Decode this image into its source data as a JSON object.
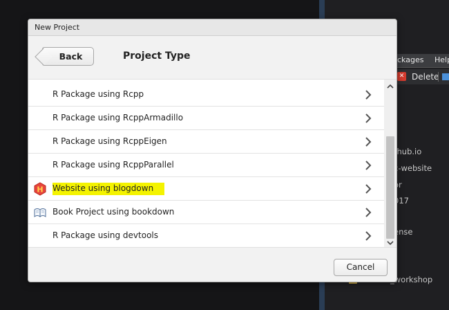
{
  "background": {
    "tabs": [
      "ckages",
      "Help"
    ],
    "toolbar": {
      "delete_label": "Delete"
    },
    "files": [
      "thub.io",
      "c-website",
      "or",
      "017",
      "ense",
      "_workshop"
    ]
  },
  "dialog": {
    "title": "New Project",
    "back_label": "Back",
    "page_title": "Project Type",
    "cancel_label": "Cancel",
    "items": [
      {
        "label": "R Package using Rcpp",
        "icon": null
      },
      {
        "label": "R Package using RcppArmadillo",
        "icon": null
      },
      {
        "label": "R Package using RcppEigen",
        "icon": null
      },
      {
        "label": "R Package using RcppParallel",
        "icon": null
      },
      {
        "label": "Website using blogdown",
        "icon": "hugo-logo-icon",
        "highlighted": true
      },
      {
        "label": "Book Project using bookdown",
        "icon": "open-book-icon"
      },
      {
        "label": "R Package using devtools",
        "icon": null
      }
    ]
  },
  "colors": {
    "highlight": "#f4f300",
    "hugo_logo": "#e8453c",
    "dialog_bg": "#f2f2f2",
    "ide_bg": "#151517",
    "ide_accent": "#2a3d55"
  }
}
